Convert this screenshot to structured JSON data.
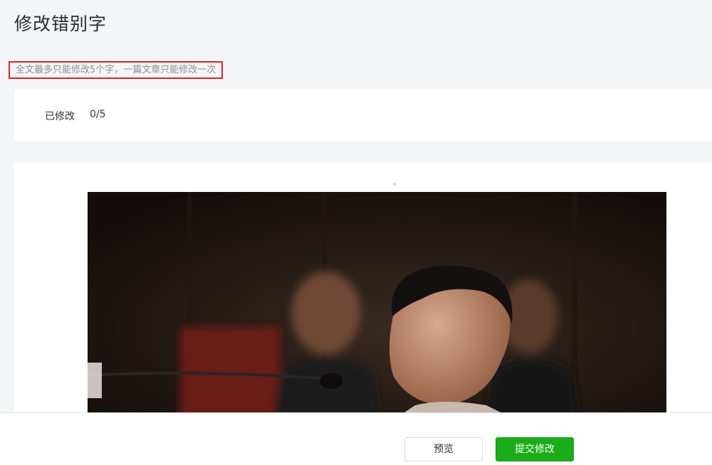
{
  "page": {
    "title": "修改错别字",
    "notice": "全文最多只能修改5个字，一篇文章只能修改一次"
  },
  "counter": {
    "label": "已修改",
    "value": "0/5"
  },
  "article": {
    "image_description": "photo-courtroom-man-speaking-at-microphone"
  },
  "footer": {
    "preview_label": "预览",
    "submit_label": "提交修改"
  },
  "colors": {
    "notice_border": "#e0212b",
    "submit_bg": "#1aad19",
    "page_bg": "#f4f5f7"
  }
}
